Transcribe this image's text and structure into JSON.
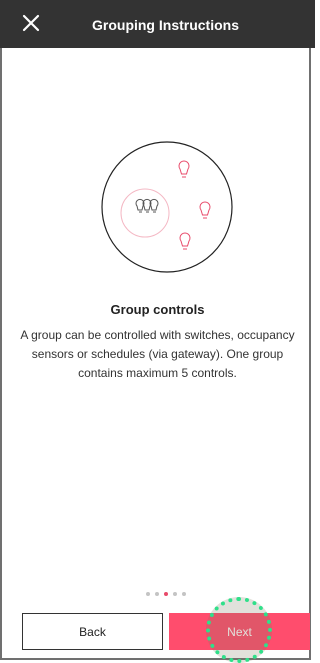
{
  "header": {
    "title": "Grouping Instructions",
    "close_icon": "close-icon"
  },
  "content": {
    "title": "Group controls",
    "description": "A group can be controlled with switches, occupancy sensors or schedules (via gateway). One group contains maximum 5 controls."
  },
  "pager": {
    "total": 5,
    "active_index": 2
  },
  "buttons": {
    "back_label": "Back",
    "next_label": "Next"
  },
  "colors": {
    "header_bg": "#333333",
    "accent": "#ff4d6d",
    "bulb": "#e84a6a",
    "highlight": "#2fe08a"
  }
}
